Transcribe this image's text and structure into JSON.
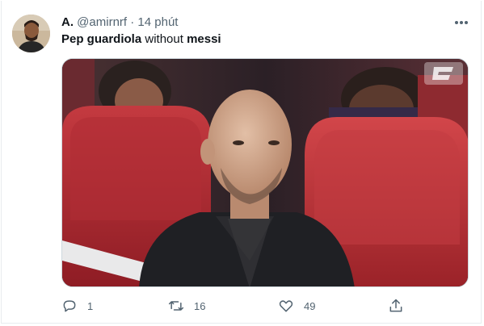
{
  "tweet": {
    "display_name": "A.",
    "handle": "@amirnrf",
    "separator": "·",
    "time": "14 phút",
    "text": {
      "part1_bold": "Pep guardiola",
      "part2": " without ",
      "part3_bold": "messi"
    },
    "media_alt": "photo",
    "actions": {
      "reply_count": "1",
      "retweet_count": "16",
      "like_count": "49"
    }
  },
  "icons": {
    "more": "more-horizontal-icon",
    "reply": "reply-icon",
    "retweet": "retweet-icon",
    "like": "heart-icon",
    "share": "share-icon"
  },
  "colors": {
    "name": "#0f1419",
    "secondary": "#536471",
    "border": "#cfd9de",
    "seat_red": "#b4232d"
  }
}
